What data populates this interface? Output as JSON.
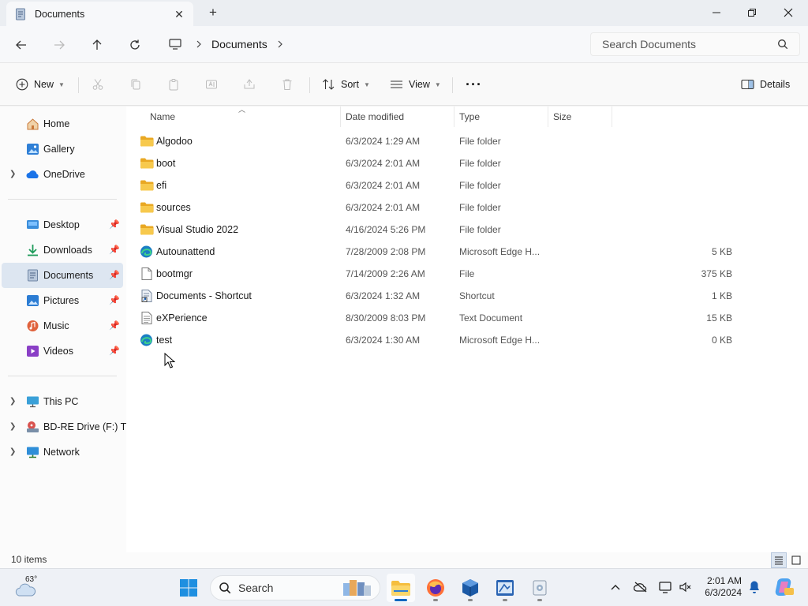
{
  "window": {
    "tab_title": "Documents",
    "tab_close": "✕",
    "new_tab": "+"
  },
  "address": {
    "path": "Documents",
    "search_placeholder": "Search Documents"
  },
  "commands": {
    "new": "New",
    "sort": "Sort",
    "view": "View",
    "more": "···",
    "details": "Details"
  },
  "sidebar": {
    "items": [
      {
        "label": "Home",
        "icon": "home-icon"
      },
      {
        "label": "Gallery",
        "icon": "gallery-icon"
      },
      {
        "label": "OneDrive",
        "icon": "onedrive-icon"
      },
      {
        "label": "Desktop",
        "icon": "desktop-icon"
      },
      {
        "label": "Downloads",
        "icon": "downloads-icon"
      },
      {
        "label": "Documents",
        "icon": "documents-icon"
      },
      {
        "label": "Pictures",
        "icon": "pictures-icon"
      },
      {
        "label": "Music",
        "icon": "music-icon"
      },
      {
        "label": "Videos",
        "icon": "videos-icon"
      },
      {
        "label": "This PC",
        "icon": "pc-icon"
      },
      {
        "label": "BD-RE Drive (F:) Tir",
        "icon": "drive-icon"
      },
      {
        "label": "Network",
        "icon": "network-icon"
      }
    ],
    "selected": "Documents"
  },
  "columns": {
    "name": "Name",
    "date": "Date modified",
    "type": "Type",
    "size": "Size"
  },
  "files": [
    {
      "name": "Algodoo",
      "date": "6/3/2024 1:29 AM",
      "type": "File folder",
      "size": "",
      "icon": "folder-icon"
    },
    {
      "name": "boot",
      "date": "6/3/2024 2:01 AM",
      "type": "File folder",
      "size": "",
      "icon": "folder-icon"
    },
    {
      "name": "efi",
      "date": "6/3/2024 2:01 AM",
      "type": "File folder",
      "size": "",
      "icon": "folder-icon"
    },
    {
      "name": "sources",
      "date": "6/3/2024 2:01 AM",
      "type": "File folder",
      "size": "",
      "icon": "folder-icon"
    },
    {
      "name": "Visual Studio 2022",
      "date": "4/16/2024 5:26 PM",
      "type": "File folder",
      "size": "",
      "icon": "folder-icon"
    },
    {
      "name": "Autounattend",
      "date": "7/28/2009 2:08 PM",
      "type": "Microsoft Edge H...",
      "size": "5 KB",
      "icon": "edge-file-icon"
    },
    {
      "name": "bootmgr",
      "date": "7/14/2009 2:26 AM",
      "type": "File",
      "size": "375 KB",
      "icon": "file-icon"
    },
    {
      "name": "Documents - Shortcut",
      "date": "6/3/2024 1:32 AM",
      "type": "Shortcut",
      "size": "1 KB",
      "icon": "shortcut-icon"
    },
    {
      "name": "eXPerience",
      "date": "8/30/2009 8:03 PM",
      "type": "Text Document",
      "size": "15 KB",
      "icon": "text-file-icon"
    },
    {
      "name": "test",
      "date": "6/3/2024 1:30 AM",
      "type": "Microsoft Edge H...",
      "size": "0 KB",
      "icon": "edge-file-icon"
    }
  ],
  "status": {
    "item_count": "10 items"
  },
  "taskbar": {
    "weather_temp": "63°",
    "search_label": "Search",
    "time": "2:01 AM",
    "date": "6/3/2024"
  },
  "colors": {
    "accent": "#0067c0",
    "folder": "#f4c04a",
    "selection": "#dde6f1"
  }
}
